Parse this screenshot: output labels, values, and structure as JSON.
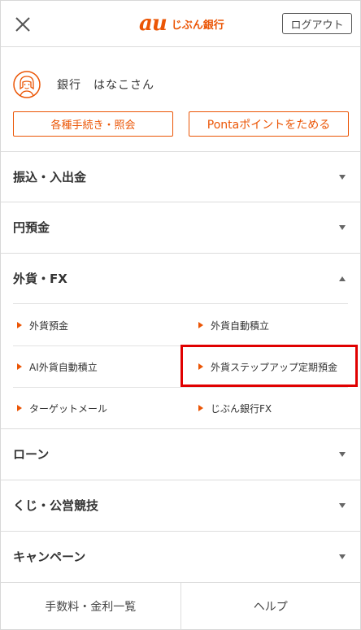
{
  "header": {
    "logo_au": "au",
    "logo_name": "じぶん銀行",
    "logout_label": "ログアウト"
  },
  "user": {
    "name": "銀行　はなこさん",
    "procedures_label": "各種手続き・照会",
    "ponta_label": "Pontaポイントをためる"
  },
  "menu": [
    {
      "label": "振込・入出金",
      "expanded": false
    },
    {
      "label": "円預金",
      "expanded": false
    },
    {
      "label": "外貨・FX",
      "expanded": true
    },
    {
      "label": "ローン",
      "expanded": false
    },
    {
      "label": "くじ・公営競技",
      "expanded": false
    },
    {
      "label": "キャンペーン",
      "expanded": false
    }
  ],
  "fx_items": [
    {
      "label": "外貨預金"
    },
    {
      "label": "外貨自動積立"
    },
    {
      "label": "AI外貨自動積立"
    },
    {
      "label": "外貨ステップアップ定期預金"
    },
    {
      "label": "ターゲットメール"
    },
    {
      "label": "じぶん銀行FX"
    }
  ],
  "footer": {
    "fees_label": "手数料・金利一覧",
    "help_label": "ヘルプ"
  },
  "colors": {
    "accent": "#eb5505",
    "highlight": "#e00000"
  },
  "icons": {
    "close": "close-icon",
    "avatar": "user-avatar-icon",
    "expand": "chevron-down-icon",
    "collapse": "chevron-up-icon",
    "bullet": "triangle-right-icon"
  }
}
